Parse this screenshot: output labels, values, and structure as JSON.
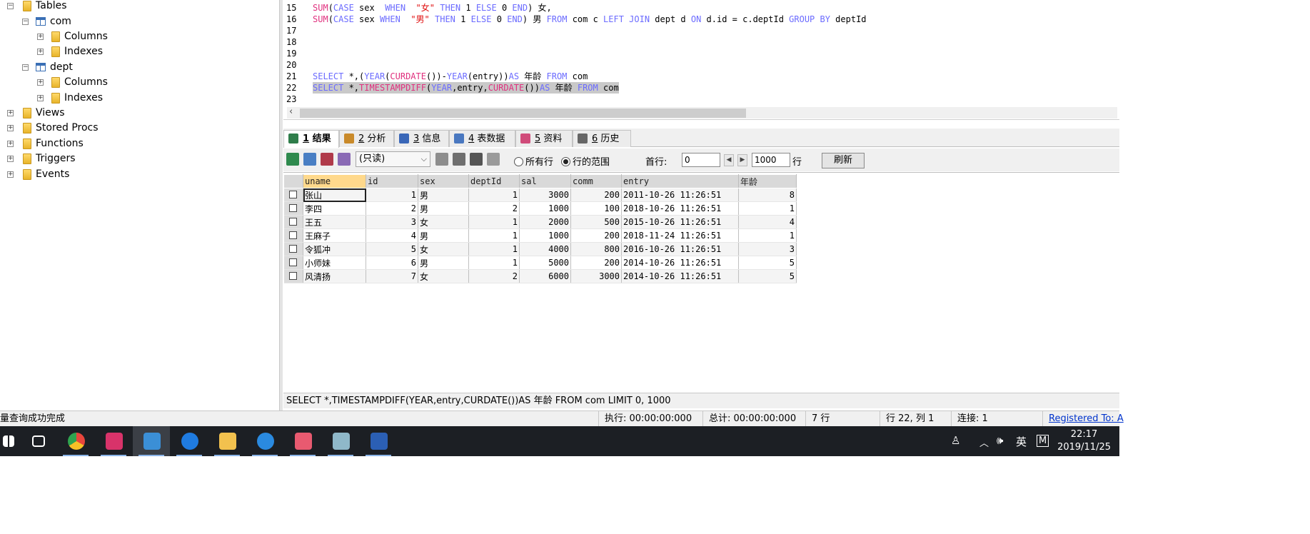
{
  "tree": {
    "items": [
      {
        "label": "Tables",
        "level": 0,
        "expanded": true,
        "kind": "folder"
      },
      {
        "label": "com",
        "level": 1,
        "expanded": true,
        "kind": "table"
      },
      {
        "label": "Columns",
        "level": 2,
        "expanded": false,
        "kind": "folder"
      },
      {
        "label": "Indexes",
        "level": 2,
        "expanded": false,
        "kind": "folder"
      },
      {
        "label": "dept",
        "level": 1,
        "expanded": true,
        "kind": "table"
      },
      {
        "label": "Columns",
        "level": 2,
        "expanded": false,
        "kind": "folder"
      },
      {
        "label": "Indexes",
        "level": 2,
        "expanded": false,
        "kind": "folder"
      },
      {
        "label": "Views",
        "level": 0,
        "expanded": false,
        "kind": "folder"
      },
      {
        "label": "Stored Procs",
        "level": 0,
        "expanded": false,
        "kind": "folder"
      },
      {
        "label": "Functions",
        "level": 0,
        "expanded": false,
        "kind": "folder"
      },
      {
        "label": "Triggers",
        "level": 0,
        "expanded": false,
        "kind": "folder"
      },
      {
        "label": "Events",
        "level": 0,
        "expanded": false,
        "kind": "folder"
      }
    ]
  },
  "editor": {
    "line_numbers": [
      "15",
      "16",
      "17",
      "18",
      "19",
      "20",
      "21",
      "22",
      "23"
    ],
    "lines": {
      "l15": [
        "SUM",
        "(",
        "CASE",
        " sex  ",
        "WHEN",
        "  ",
        "\"女\"",
        " ",
        "THEN",
        " 1 ",
        "ELSE",
        " 0 ",
        "END",
        ") 女,"
      ],
      "l16": [
        "SUM",
        "(",
        "CASE",
        " sex ",
        "WHEN",
        "  ",
        "\"男\"",
        " ",
        "THEN",
        " 1 ",
        "ELSE",
        " 0 ",
        "END",
        ") 男 ",
        "FROM",
        " com c ",
        "LEFT JOIN",
        " dept d ",
        "ON",
        " d.id = c.deptId ",
        "GROUP BY",
        " deptId"
      ],
      "l21": [
        "SELECT",
        " *,(",
        "YEAR",
        "(",
        "CURDATE",
        "())-",
        "YEAR",
        "(entry))",
        "AS",
        " 年龄 ",
        "FROM",
        " com"
      ],
      "l22": [
        "SELECT",
        " *,",
        "TIMESTAMPDIFF",
        "(",
        "YEAR",
        ",entry,",
        "CURDATE",
        "())",
        "AS",
        " 年龄 ",
        "FROM",
        " com"
      ]
    }
  },
  "tabs": [
    {
      "num": "1",
      "label": "结果",
      "active": true
    },
    {
      "num": "2",
      "label": "分析",
      "active": false
    },
    {
      "num": "3",
      "label": "信息",
      "active": false
    },
    {
      "num": "4",
      "label": "表数据",
      "active": false
    },
    {
      "num": "5",
      "label": "资料",
      "active": false
    },
    {
      "num": "6",
      "label": "历史",
      "active": false
    }
  ],
  "toolbar": {
    "mode": "(只读)",
    "radio_all": "所有行",
    "radio_range": "行的范围",
    "first_row_label": "首行:",
    "first_row_value": "0",
    "count_value": "1000",
    "rows_label": "行",
    "refresh_label": "刷新"
  },
  "grid": {
    "columns": [
      "uname",
      "id",
      "sex",
      "deptId",
      "sal",
      "comm",
      "entry",
      "年龄"
    ],
    "rows": [
      [
        "张山",
        "1",
        "男",
        "1",
        "3000",
        "200",
        "2011-10-26 11:26:51",
        "8"
      ],
      [
        "李四",
        "2",
        "男",
        "2",
        "1000",
        "100",
        "2018-10-26 11:26:51",
        "1"
      ],
      [
        "王五",
        "3",
        "女",
        "1",
        "2000",
        "500",
        "2015-10-26 11:26:51",
        "4"
      ],
      [
        "王麻子",
        "4",
        "男",
        "1",
        "1000",
        "200",
        "2018-11-24 11:26:51",
        "1"
      ],
      [
        "令狐冲",
        "5",
        "女",
        "1",
        "4000",
        "800",
        "2016-10-26 11:26:51",
        "3"
      ],
      [
        "小师妹",
        "6",
        "男",
        "1",
        "5000",
        "200",
        "2014-10-26 11:26:51",
        "5"
      ],
      [
        "风清扬",
        "7",
        "女",
        "2",
        "6000",
        "3000",
        "2014-10-26 11:26:51",
        "5"
      ]
    ]
  },
  "sql_status": "SELECT *,TIMESTAMPDIFF(YEAR,entry,CURDATE())AS 年龄 FROM com  LIMIT 0, 1000",
  "status": {
    "message": "量查询成功完成",
    "exec": "执行: 00:00:00:000",
    "total": "总计: 00:00:00:000",
    "rows": "7 行",
    "position": "行 22, 列 1",
    "connection": "连接: 1",
    "registered": "Registered To: A"
  },
  "taskbar": {
    "apps": [
      "start-icon",
      "task-view-icon",
      "chrome-icon",
      "intellij-icon",
      "sqlyog-icon",
      "sogou-icon",
      "file-explorer-icon",
      "clock-app-icon",
      "mail-app-icon",
      "notepad-icon",
      "word-icon"
    ],
    "ime": "英",
    "time": "22:17",
    "date": "2019/11/25"
  },
  "colors": {
    "keyword": "#6b6bff",
    "function": "#e0307e",
    "string": "#e01010",
    "taskbar": "#1c1f24"
  }
}
